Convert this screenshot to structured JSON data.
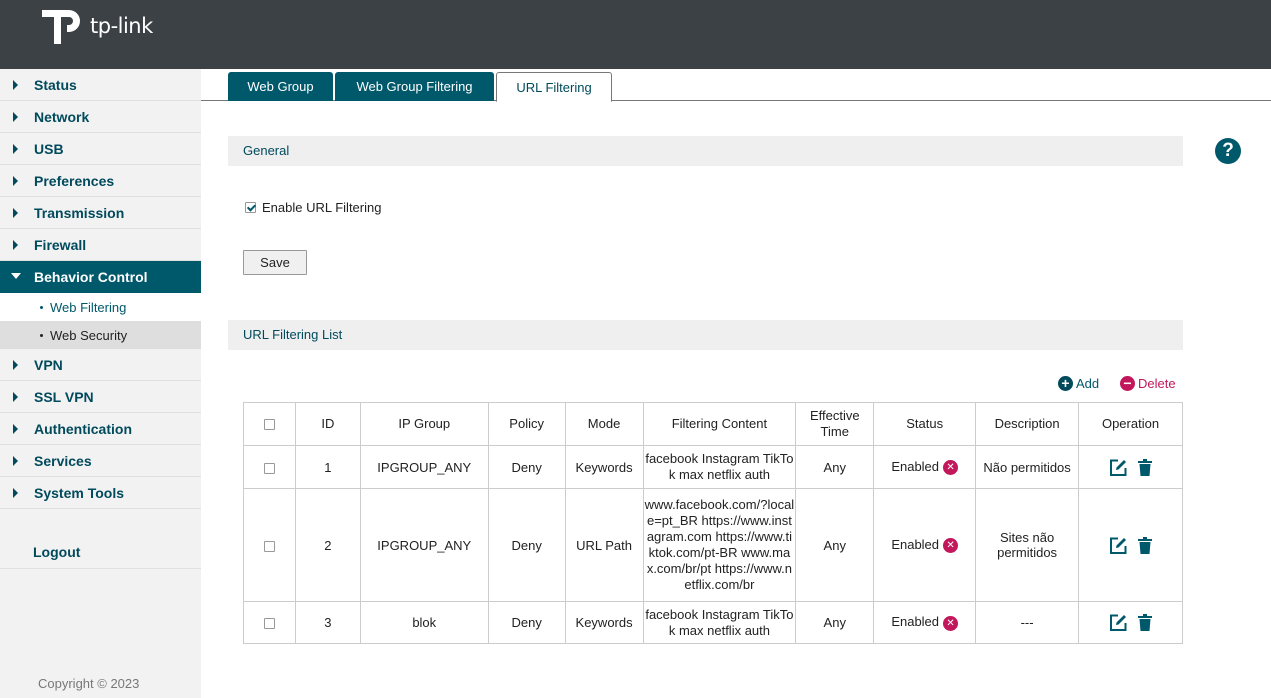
{
  "brand": {
    "logo_text": "tp-link"
  },
  "sidebar": {
    "items": [
      {
        "label": "Status"
      },
      {
        "label": "Network"
      },
      {
        "label": "USB"
      },
      {
        "label": "Preferences"
      },
      {
        "label": "Transmission"
      },
      {
        "label": "Firewall"
      },
      {
        "label": "Behavior Control"
      },
      {
        "label": "VPN"
      },
      {
        "label": "SSL VPN"
      },
      {
        "label": "Authentication"
      },
      {
        "label": "Services"
      },
      {
        "label": "System Tools"
      }
    ],
    "subitems": [
      {
        "label": "Web Filtering"
      },
      {
        "label": "Web Security"
      }
    ],
    "logout": "Logout",
    "copyright": "Copyright © 2023"
  },
  "tabs": [
    {
      "label": "Web Group"
    },
    {
      "label": "Web Group Filtering"
    },
    {
      "label": "URL Filtering"
    }
  ],
  "general": {
    "title": "General",
    "enable_label": "Enable URL Filtering",
    "enabled": true,
    "save_label": "Save"
  },
  "help_icon": "?",
  "list": {
    "title": "URL Filtering List",
    "add_label": "Add",
    "delete_label": "Delete",
    "columns": [
      "ID",
      "IP Group",
      "Policy",
      "Mode",
      "Filtering Content",
      "Effective Time",
      "Status",
      "Description",
      "Operation"
    ],
    "rows": [
      {
        "id": "1",
        "ip_group": "IPGROUP_ANY",
        "policy": "Deny",
        "mode": "Keywords",
        "content": "facebook Instagram TikTok max netflix auth",
        "time": "Any",
        "status": "Enabled",
        "description": "Não permitidos"
      },
      {
        "id": "2",
        "ip_group": "IPGROUP_ANY",
        "policy": "Deny",
        "mode": "URL Path",
        "content": "www.facebook.com/?locale=pt_BR https://www.instagram.com https://www.tiktok.com/pt-BR www.max.com/br/pt https://www.netflix.com/br",
        "time": "Any",
        "status": "Enabled",
        "description": "Sites não permitidos"
      },
      {
        "id": "3",
        "ip_group": "blok",
        "policy": "Deny",
        "mode": "Keywords",
        "content": "facebook Instagram TikTok max netflix auth",
        "time": "Any",
        "status": "Enabled",
        "description": "---"
      }
    ]
  },
  "colors": {
    "accent": "#00586b",
    "header": "#3c4146",
    "danger": "#c2185b"
  }
}
